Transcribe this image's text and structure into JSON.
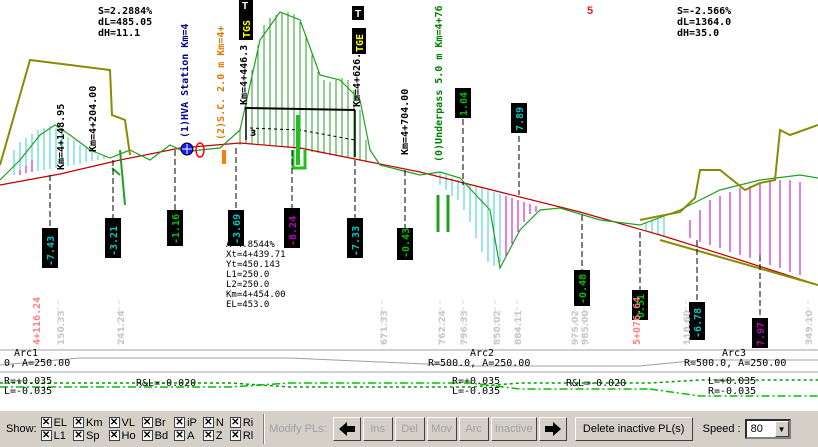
{
  "profile": {
    "top_left_stats": [
      "S=2.2884%",
      "dL=485.05",
      "dH=11.1"
    ],
    "top_right_stats": [
      "S=-2.566%",
      "dL=1364.0",
      "dH=35.0"
    ],
    "marker_top": "5",
    "vertical_labels": [
      {
        "text": "Km=4+148.95",
        "color": "#000"
      },
      {
        "text": "Km=4+204.00",
        "color": "#000"
      },
      {
        "text": "(1)HVA Station Km=4",
        "color": "#00008b"
      },
      {
        "text": "(2)S.C. 2.0 m Km=4+",
        "color": "#e07800"
      },
      {
        "text": "Km=4+446.3",
        "color": "#000"
      },
      {
        "text": "Km=4+626.3",
        "color": "#000"
      },
      {
        "text": "Km=4+704.00",
        "color": "#000"
      },
      {
        "text": "(0)Underpass 5.0 m Km=4+76",
        "color": "#008000"
      }
    ],
    "tags": [
      "TGS",
      "TGE"
    ],
    "t_badges": [
      "T",
      "T"
    ],
    "number_three": "3",
    "pvi_info": [
      "A=4.8544%",
      "Xt=4+439.71",
      "Yt=450.143",
      "L1=250.0",
      "L2=250.0",
      "Km=4+454.00",
      "EL=453.0"
    ],
    "depth_boxes": [
      {
        "text": "-7.43",
        "color": "#00c8c8"
      },
      {
        "text": "-3.21",
        "color": "#00c8c8"
      },
      {
        "text": "-1.16",
        "color": "#00c000"
      },
      {
        "text": "-3.69",
        "color": "#00c8c8"
      },
      {
        "text": "-8.24",
        "color": "#c000c0"
      },
      {
        "text": "-7.33",
        "color": "#00c8c8"
      },
      {
        "text": "-0.43",
        "color": "#00c000"
      },
      {
        "text": "1.04",
        "color": "#00c000"
      },
      {
        "text": "7.89",
        "color": "#00c8c8"
      },
      {
        "text": "-0.48",
        "color": "#00c000"
      },
      {
        "text": "0.51",
        "color": "#00c000"
      },
      {
        "text": "-6.78",
        "color": "#00c8c8"
      },
      {
        "text": "7.97",
        "color": "#c000c0"
      }
    ],
    "station_labels": [
      {
        "text": "4+116.24",
        "color": "#ff8080"
      },
      {
        "text": "150.33",
        "color": "#c8c8c8"
      },
      {
        "text": "241.24",
        "color": "#c8c8c8"
      },
      {
        "text": "671.33",
        "color": "#c8c8c8"
      },
      {
        "text": "762.24",
        "color": "#c8c8c8"
      },
      {
        "text": "796.33",
        "color": "#c8c8c8"
      },
      {
        "text": "850.02",
        "color": "#c8c8c8"
      },
      {
        "text": "884.11",
        "color": "#c8c8c8"
      },
      {
        "text": "975.02",
        "color": "#c8c8c8"
      },
      {
        "text": "985.00",
        "color": "#c8c8c8"
      },
      {
        "text": "5+076.64",
        "color": "#ff8080"
      },
      {
        "text": "110.60",
        "color": "#c8c8c8"
      },
      {
        "text": "349.10",
        "color": "#c8c8c8"
      }
    ],
    "arc_bands": [
      {
        "name": "Arc1",
        "params": "0, A=250.00"
      },
      {
        "name": "Arc2",
        "params": "R=500.0, A=250.00"
      },
      {
        "name": "Arc3",
        "params": "R=500.0, A=250.00"
      }
    ],
    "superelevation": [
      "R=+0.035",
      "L=-0.035",
      "R&L=-0.020",
      "R=+0.035",
      "L=-0.035",
      "R&L=-0.020",
      "L=+0.035",
      "R=-0.035"
    ]
  },
  "toolbar": {
    "show_label": "Show:",
    "checkboxes": [
      {
        "label": "EL",
        "checked": true
      },
      {
        "label": "Km",
        "checked": true
      },
      {
        "label": "VL",
        "checked": true
      },
      {
        "label": "Br",
        "checked": true
      },
      {
        "label": "iP",
        "checked": true
      },
      {
        "label": "N",
        "checked": true
      },
      {
        "label": "Ri",
        "checked": true
      },
      {
        "label": "L1",
        "checked": true
      },
      {
        "label": "Sp",
        "checked": true
      },
      {
        "label": "Ho",
        "checked": true
      },
      {
        "label": "Bd",
        "checked": true
      },
      {
        "label": "A",
        "checked": true
      },
      {
        "label": "Z",
        "checked": true
      },
      {
        "label": "Rl",
        "checked": true
      }
    ],
    "modify_label": "Modify PLs:",
    "buttons": [
      "Ins",
      "Del",
      "Mov",
      "Arc",
      "Inactive"
    ],
    "delete_inactive": "Delete inactive PL(s)",
    "speed_label": "Speed :",
    "speed_value": "80"
  }
}
